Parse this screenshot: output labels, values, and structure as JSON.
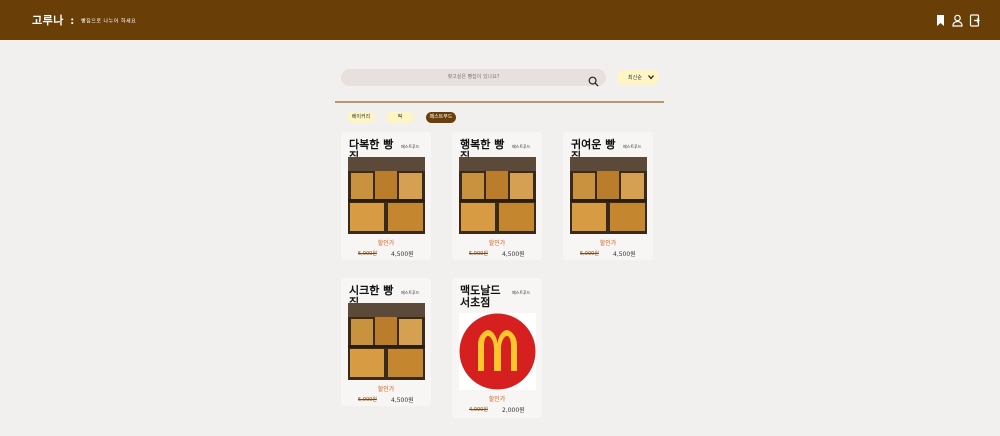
{
  "header": {
    "brand": "고루나",
    "separator": ":",
    "tagline": "빵집으로 나누어 하세요",
    "icons": [
      "bookmark-icon",
      "user-icon",
      "logout-icon"
    ],
    "bg_color": "#6a3f07"
  },
  "search": {
    "placeholder": "찾고싶은 빵집이 있나요?"
  },
  "sort": {
    "selected": "최신순"
  },
  "filters": [
    {
      "label": "베이커리",
      "active": false
    },
    {
      "label": "떡",
      "active": false
    },
    {
      "label": "패스트푸드",
      "active": true
    }
  ],
  "stores": [
    {
      "name": "다복한 빵집",
      "category": "패스트푸드",
      "discount_label": "할인가",
      "original_price": "5,000원",
      "sale_price": "4,500원",
      "image": "bakery-photo"
    },
    {
      "name": "행복한 빵집",
      "category": "패스트푸드",
      "discount_label": "할인가",
      "original_price": "5,000원",
      "sale_price": "4,500원",
      "image": "bakery-photo"
    },
    {
      "name": "귀여운 빵집",
      "category": "패스트푸드",
      "discount_label": "할인가",
      "original_price": "5,000원",
      "sale_price": "4,500원",
      "image": "bakery-photo"
    },
    {
      "name": "시크한 빵집",
      "category": "패스트푸드",
      "discount_label": "할인가",
      "original_price": "5,000원",
      "sale_price": "4,500원",
      "image": "bakery-photo"
    },
    {
      "name": "맥도날드 서초점",
      "category": "패스트푸드",
      "discount_label": "할인가",
      "original_price": "4,000원",
      "sale_price": "2,000원",
      "image": "mcdonalds-logo"
    }
  ]
}
